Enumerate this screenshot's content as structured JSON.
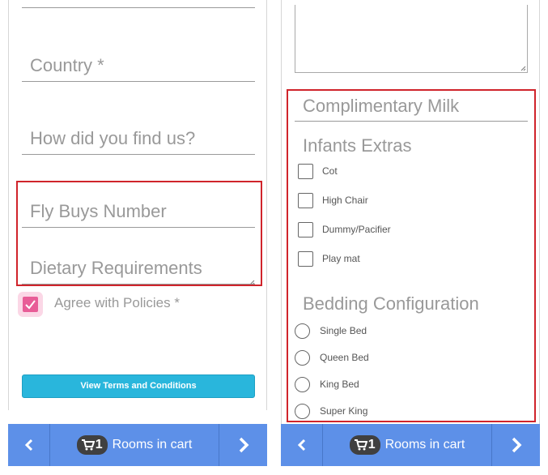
{
  "left": {
    "fields": {
      "country": "Country *",
      "how_found": "How did you find us?",
      "fly_buys": "Fly Buys Number",
      "dietary": "Dietary Requirements"
    },
    "agree_label": "Agree with Policies *",
    "agree_checked": true,
    "terms_button": "View Terms and Conditions"
  },
  "right": {
    "complimentary_milk": "Complimentary Milk",
    "infants_title": "Infants Extras",
    "infants_items": [
      "Cot",
      "High Chair",
      "Dummy/Pacifier",
      "Play mat"
    ],
    "bedding_title": "Bedding Configuration",
    "bedding_options": [
      "Single Bed",
      "Queen Bed",
      "King Bed",
      "Super King"
    ]
  },
  "bottom_bar": {
    "cart_count": "1",
    "cart_label": "Rooms in cart",
    "prev_icon": "chevron-left-icon",
    "next_icon": "chevron-right-icon",
    "cart_icon": "cart-icon"
  },
  "colors": {
    "bar": "#5d90e8",
    "highlight_border": "#d0242b",
    "terms_button": "#29b6dc",
    "checkbox_checked": "#e85d97"
  }
}
